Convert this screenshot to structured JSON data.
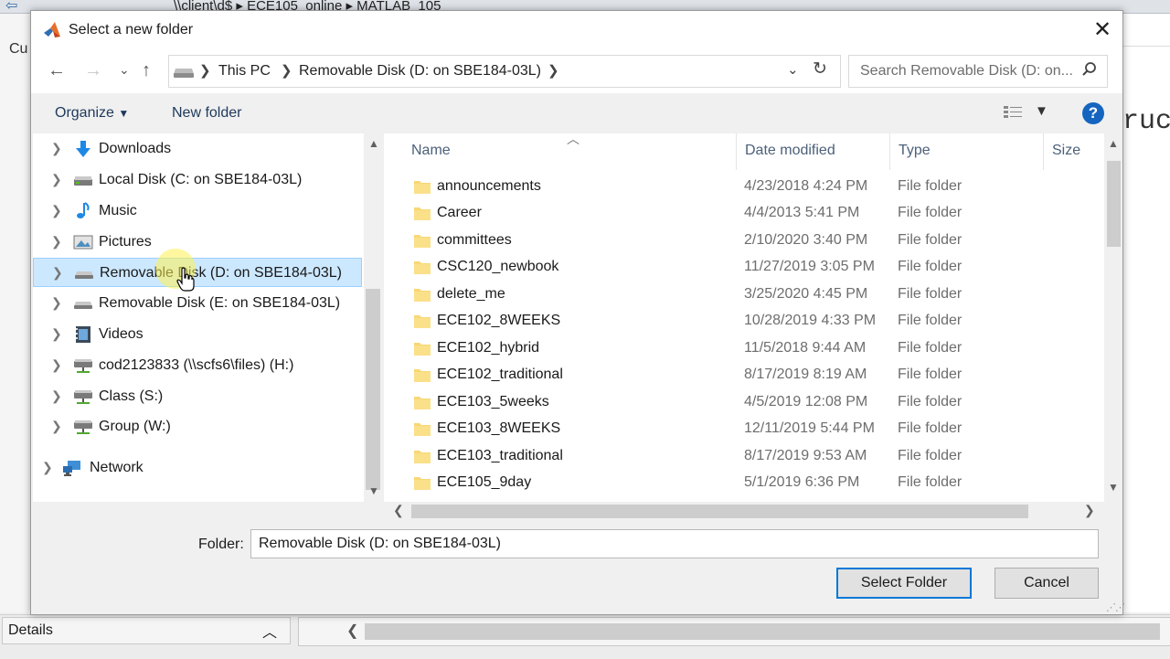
{
  "background": {
    "path_text": "\\\\client\\d$  ▸  ECE105_online  ▸  MATLAB_105",
    "left_tab_label": "Cu",
    "right_text": "ruc",
    "details_label": "Details"
  },
  "dialog": {
    "title": "Select a new folder",
    "address": {
      "crumbs": [
        "This PC",
        "Removable Disk (D: on SBE184-03L)"
      ]
    },
    "search_placeholder": "Search Removable Disk (D: on...",
    "toolbar": {
      "organize": "Organize",
      "new_folder": "New folder"
    },
    "tree": [
      {
        "label": "Downloads",
        "icon": "downloads-icon"
      },
      {
        "label": "Local Disk (C: on SBE184-03L)",
        "icon": "drive-icon"
      },
      {
        "label": "Music",
        "icon": "music-icon"
      },
      {
        "label": "Pictures",
        "icon": "pictures-icon"
      },
      {
        "label": "Removable Disk (D: on SBE184-03L)",
        "icon": "removable-drive-icon",
        "selected": true
      },
      {
        "label": "Removable Disk (E: on SBE184-03L)",
        "icon": "removable-drive-icon"
      },
      {
        "label": "Videos",
        "icon": "videos-icon"
      },
      {
        "label": "cod2123833 (\\\\scfs6\\files) (H:)",
        "icon": "network-drive-icon"
      },
      {
        "label": "Class (S:)",
        "icon": "network-drive-icon"
      },
      {
        "label": "Group (W:)",
        "icon": "network-drive-icon"
      },
      {
        "label": "Network",
        "icon": "network-icon"
      }
    ],
    "columns": {
      "name": "Name",
      "date": "Date modified",
      "type": "Type",
      "size": "Size"
    },
    "files": [
      {
        "name": "announcements",
        "date": "4/23/2018 4:24 PM",
        "type": "File folder"
      },
      {
        "name": "Career",
        "date": "4/4/2013 5:41 PM",
        "type": "File folder"
      },
      {
        "name": "committees",
        "date": "2/10/2020 3:40 PM",
        "type": "File folder"
      },
      {
        "name": "CSC120_newbook",
        "date": "11/27/2019 3:05 PM",
        "type": "File folder"
      },
      {
        "name": "delete_me",
        "date": "3/25/2020 4:45 PM",
        "type": "File folder"
      },
      {
        "name": "ECE102_8WEEKS",
        "date": "10/28/2019 4:33 PM",
        "type": "File folder"
      },
      {
        "name": "ECE102_hybrid",
        "date": "11/5/2018 9:44 AM",
        "type": "File folder"
      },
      {
        "name": "ECE102_traditional",
        "date": "8/17/2019 8:19 AM",
        "type": "File folder"
      },
      {
        "name": "ECE103_5weeks",
        "date": "4/5/2019 12:08 PM",
        "type": "File folder"
      },
      {
        "name": "ECE103_8WEEKS",
        "date": "12/11/2019 5:44 PM",
        "type": "File folder"
      },
      {
        "name": "ECE103_traditional",
        "date": "8/17/2019 9:53 AM",
        "type": "File folder"
      },
      {
        "name": "ECE105_9day",
        "date": "5/1/2019 6:36 PM",
        "type": "File folder"
      }
    ],
    "folder_label": "Folder:",
    "folder_value": "Removable Disk (D: on SBE184-03L)",
    "select_button": "Select Folder",
    "cancel_button": "Cancel"
  },
  "colors": {
    "accent": "#0078d7",
    "selection": "#cce8ff",
    "folder": "#f8d775"
  }
}
